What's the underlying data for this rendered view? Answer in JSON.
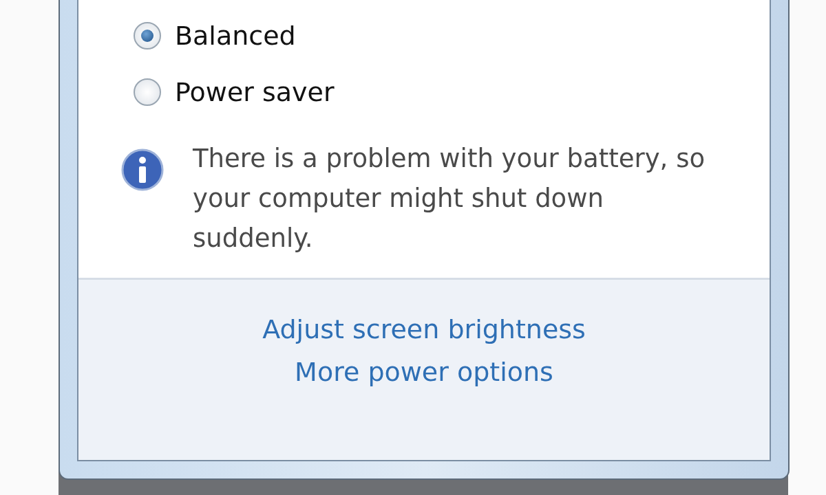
{
  "power_plans": [
    {
      "label": "Balanced",
      "selected": true
    },
    {
      "label": "Power saver",
      "selected": false
    }
  ],
  "notice": {
    "text": "There is a problem with your battery, so your computer might shut down suddenly."
  },
  "links": [
    "Adjust screen brightness",
    "More power options"
  ]
}
